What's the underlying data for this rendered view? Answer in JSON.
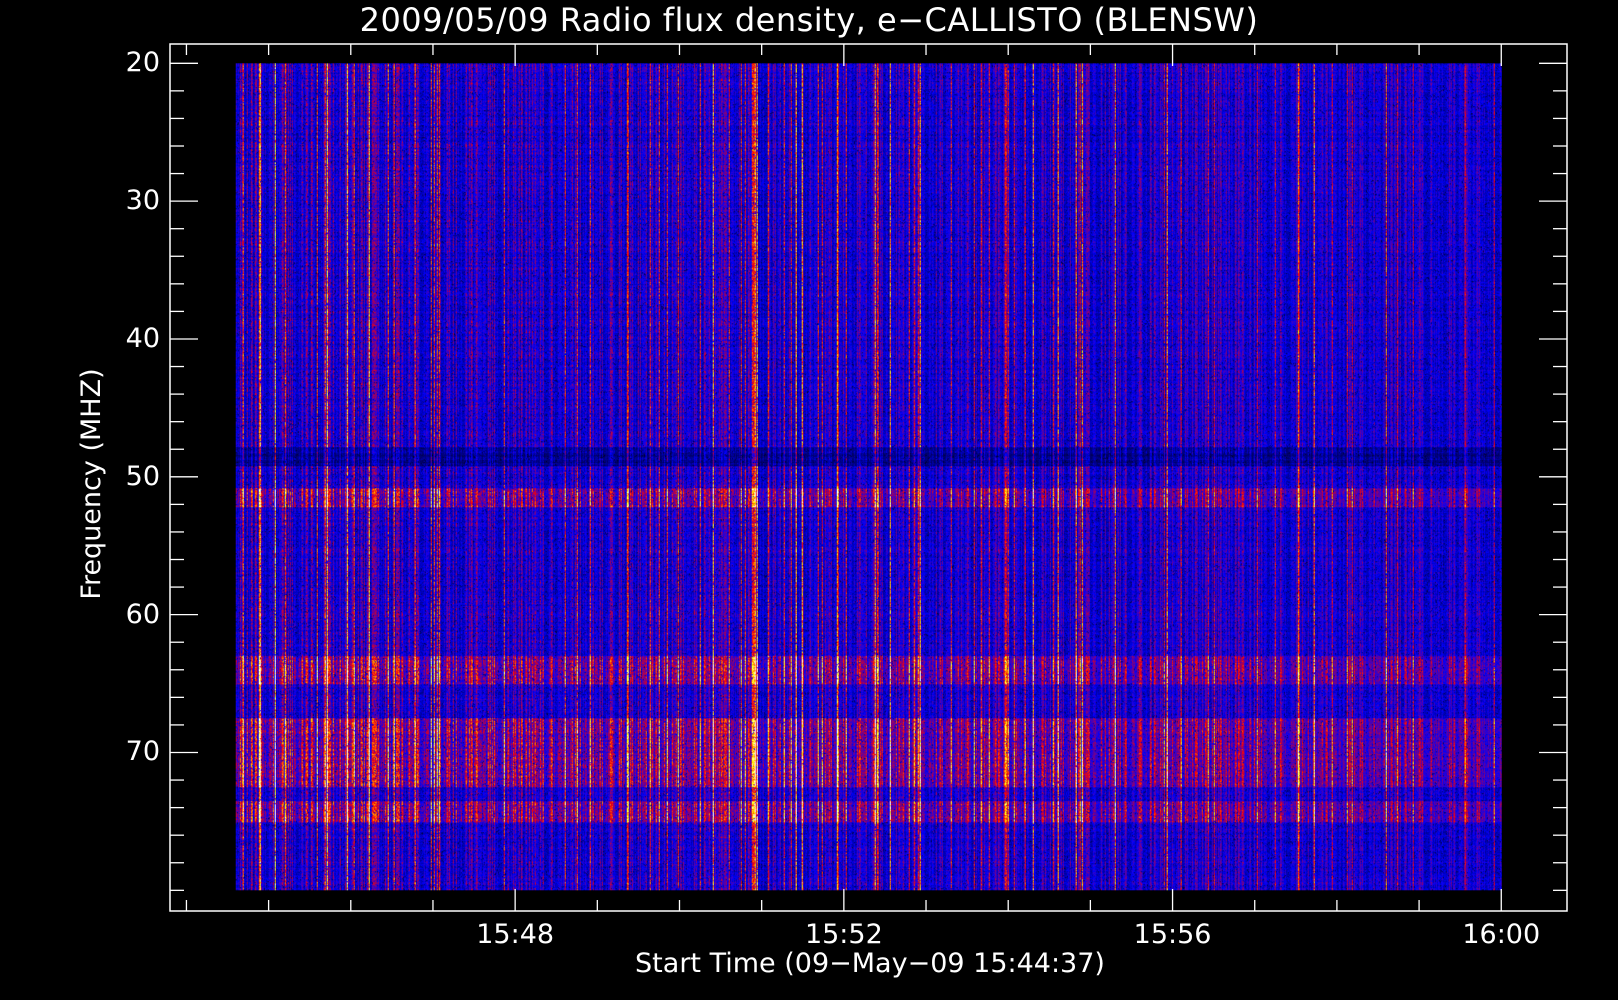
{
  "chart_data": {
    "type": "heatmap",
    "title": "2009/05/09  Radio flux density, e−CALLISTO (BLENSW)",
    "xlabel": "Start Time (09−May−09 15:44:37)",
    "ylabel": "Frequency (MHZ)",
    "x_tick_labels": [
      "15:48",
      "15:52",
      "15:56",
      "16:00"
    ],
    "x_ticks_minutes": [
      228,
      232,
      236,
      240
    ],
    "x_data_range_minutes": [
      224.6,
      240.0
    ],
    "x_axis_range_minutes": [
      223.8,
      240.8
    ],
    "y_tick_labels": [
      "20",
      "30",
      "40",
      "50",
      "60",
      "70"
    ],
    "y_ticks": [
      20,
      30,
      40,
      50,
      60,
      70
    ],
    "y_data_range": [
      20,
      80
    ],
    "y_axis_range": [
      18.6,
      81.5
    ],
    "y_inverted": true,
    "colormap": [
      "#000000",
      "#0000ff",
      "#ff0000",
      "#ffff00",
      "#ffffff"
    ],
    "background": "#000000",
    "axis_color": "#ffffff",
    "grid": false
  }
}
